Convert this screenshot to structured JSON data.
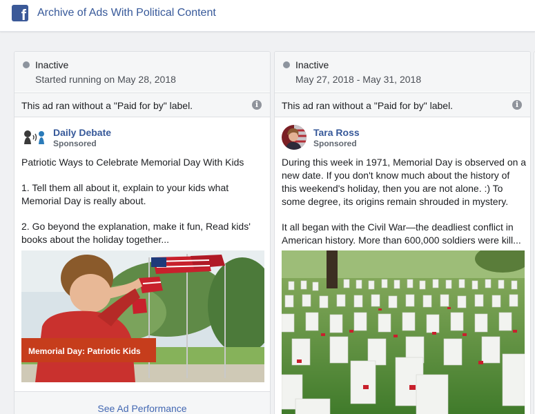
{
  "header": {
    "logo_letter": "f",
    "title": "Archive of Ads With Political Content"
  },
  "colors": {
    "brand": "#3b5998",
    "link": "#365899",
    "status_inactive": "#8d949e"
  },
  "ads": [
    {
      "status": "Inactive",
      "date": "Started running on May 28, 2018",
      "disclaimer": "This ad ran without a \"Paid for by\" label.",
      "advertiser": "Daily Debate",
      "sponsored": "Sponsored",
      "avatar_icon": "speaking-heads-icon",
      "body": [
        "Patriotic Ways to Celebrate Memorial Day With Kids",
        "1. Tell them all about it, explain to your kids what Memorial Day is really about.",
        "2. Go beyond the explanation, make it fun, Read kids' books about the holiday together..."
      ],
      "image_caption": "Memorial Day: Patriotic Kids",
      "footer_link": "See Ad Performance"
    },
    {
      "status": "Inactive",
      "date": "May 27, 2018 - May 31, 2018",
      "disclaimer": "This ad ran without a \"Paid for by\" label.",
      "advertiser": "Tara Ross",
      "sponsored": "Sponsored",
      "avatar_icon": "profile-photo-icon",
      "body": [
        "During this week in 1971, Memorial Day is observed on a new date. If you don't know much about the history of this weekend's holiday, then you are not alone. :) To some degree, its origins remain shrouded in mystery.",
        "It all began with the Civil War—the deadliest conflict in American history. More than 600,000 soldiers were kill..."
      ],
      "image_description": "cemetery-with-flags"
    }
  ]
}
